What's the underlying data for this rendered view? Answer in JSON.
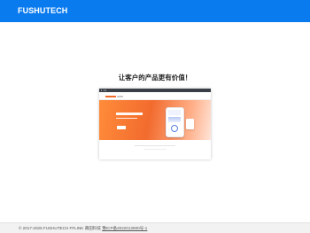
{
  "header": {
    "brand": "FUSHUTECH",
    "bar_color": "#0a7bef"
  },
  "main": {
    "headline": "让客户的产品更有价值！",
    "preview_icon": "product-screenshot"
  },
  "footer": {
    "copyright": "© 2017-2025 FUSHUTECH FFLINK 莆田科技",
    "icp_link": "豫ICP备2022012800号-1"
  }
}
